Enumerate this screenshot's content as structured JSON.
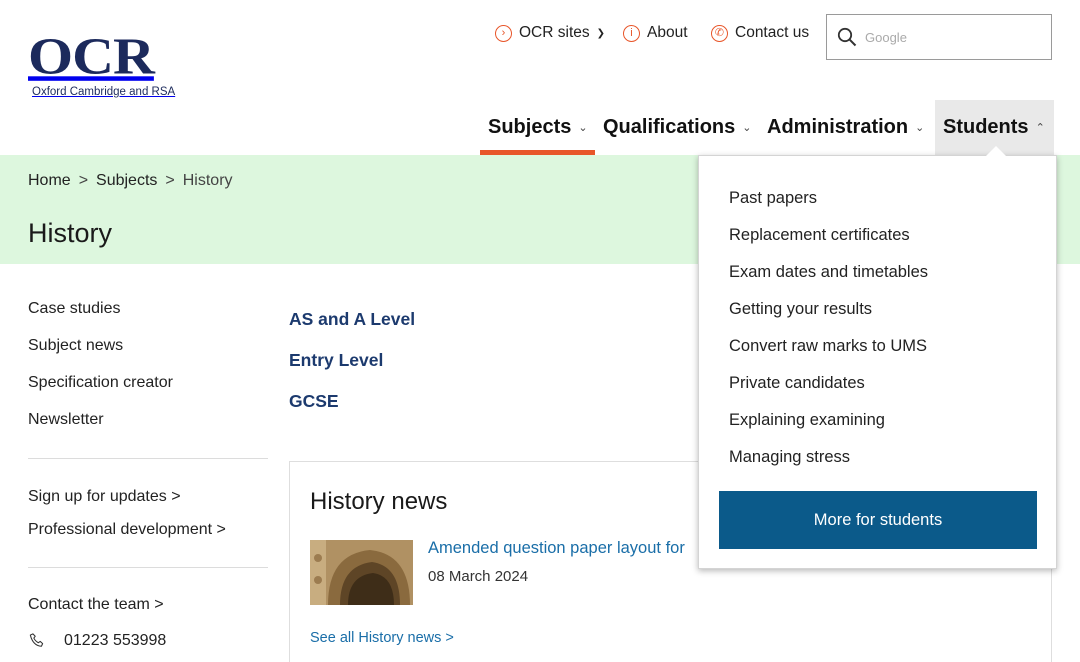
{
  "header": {
    "logo_letters": "OCR",
    "logo_tagline": "Oxford Cambridge and RSA",
    "util_links": {
      "sites": "OCR sites",
      "about": "About",
      "contact": "Contact us"
    },
    "search": {
      "placeholder": "Google"
    },
    "nav": {
      "subjects": "Subjects",
      "qualifications": "Qualifications",
      "administration": "Administration",
      "students": "Students"
    }
  },
  "breadcrumb": {
    "home": "Home",
    "subjects": "Subjects",
    "current": "History",
    "separator": ">"
  },
  "page_title": "History",
  "sidebar": {
    "links": [
      "Case studies",
      "Subject news",
      "Specification creator",
      "Newsletter"
    ],
    "actions": [
      "Sign up for updates >",
      "Professional development >"
    ],
    "contact_team": "Contact the team >",
    "phone": "01223 553998"
  },
  "qualifications": [
    "AS and A Level",
    "Entry Level",
    "GCSE"
  ],
  "news": {
    "heading": "History news",
    "item_title": "Amended question paper layout for",
    "item_date": "08 March 2024",
    "see_all": "See all History news >"
  },
  "students_menu": {
    "items": [
      "Past papers",
      "Replacement certificates",
      "Exam dates and timetables",
      "Getting your results",
      "Convert raw marks to UMS",
      "Private candidates",
      "Explaining examining",
      "Managing stress"
    ],
    "button": "More for students"
  },
  "colors": {
    "brand_navy": "#1c2a5c",
    "accent_orange": "#e8562a",
    "band_green": "#ddf7de",
    "link_blue": "#1a6ea8",
    "button_blue": "#0b5a8a"
  }
}
